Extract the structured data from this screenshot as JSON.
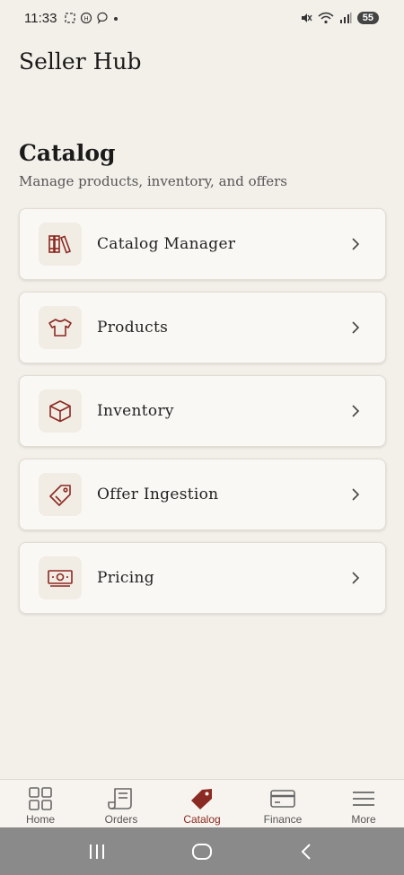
{
  "status": {
    "time": "11:33",
    "battery": "55"
  },
  "header": {
    "title": "Seller Hub"
  },
  "section": {
    "title": "Catalog",
    "subtitle": "Manage products, inventory, and offers"
  },
  "cards": [
    {
      "label": "Catalog Manager",
      "icon": "books-icon"
    },
    {
      "label": "Products",
      "icon": "tshirt-icon"
    },
    {
      "label": "Inventory",
      "icon": "box-icon"
    },
    {
      "label": "Offer Ingestion",
      "icon": "tag-icon"
    },
    {
      "label": "Pricing",
      "icon": "cash-icon"
    }
  ],
  "bottom_nav": [
    {
      "label": "Home",
      "icon": "grid-icon",
      "active": false
    },
    {
      "label": "Orders",
      "icon": "receipt-icon",
      "active": false
    },
    {
      "label": "Catalog",
      "icon": "tag-filled-icon",
      "active": true
    },
    {
      "label": "Finance",
      "icon": "card-icon",
      "active": false
    },
    {
      "label": "More",
      "icon": "menu-icon",
      "active": false
    }
  ],
  "colors": {
    "accent": "#8b2a22",
    "background": "#f3f0ea",
    "card_background": "#faf8f4"
  }
}
